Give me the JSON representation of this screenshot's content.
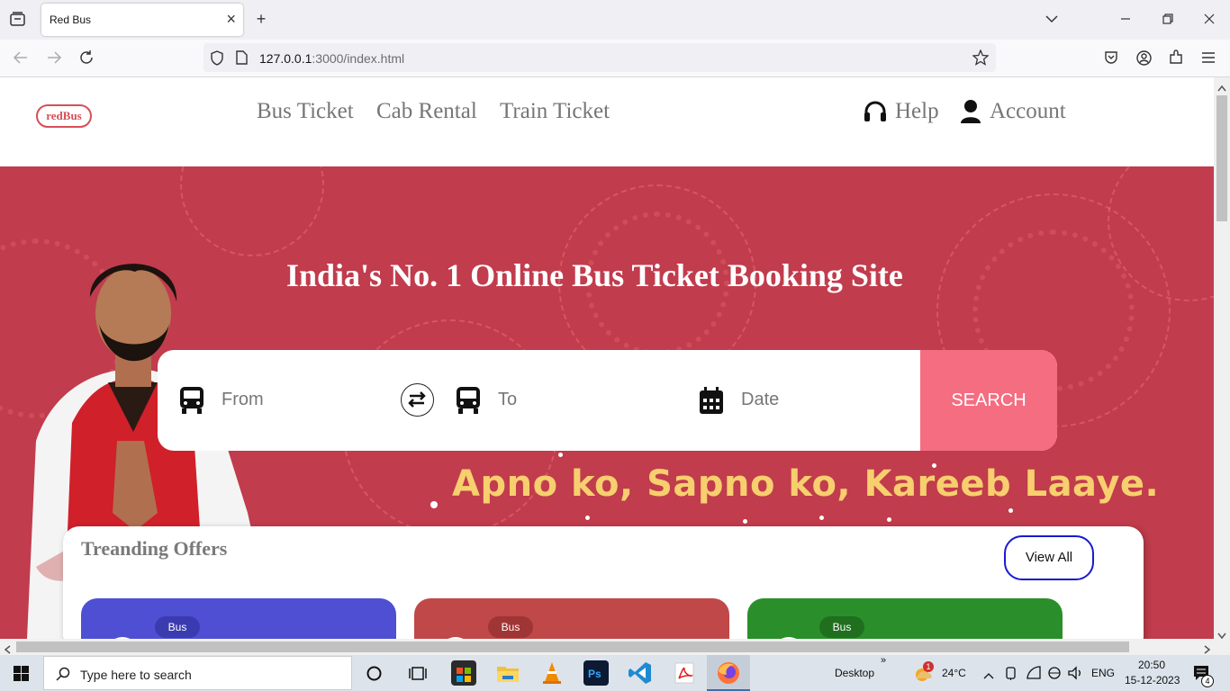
{
  "browser": {
    "tab_title": "Red Bus",
    "url_host": "127.0.0.1",
    "url_path": ":3000/index.html"
  },
  "header": {
    "logo_text": "redBus",
    "nav": [
      "Bus Ticket",
      "Cab Rental",
      "Train Ticket"
    ],
    "help": "Help",
    "account": "Account"
  },
  "hero": {
    "headline": "India's No. 1 Online Bus Ticket Booking Site",
    "tagline": "Apno ko, Sapno ko, Kareeb Laaye.",
    "search": {
      "from_placeholder": "From",
      "to_placeholder": "To",
      "date_placeholder": "Date",
      "search_label": "SEARCH"
    }
  },
  "offers": {
    "title": "Treanding Offers",
    "view_all": "View All",
    "cards": [
      {
        "badge": "Bus",
        "color": "#4f4fd4",
        "badge_color": "#3b3bb0"
      },
      {
        "badge": "Bus",
        "color": "#c04848",
        "badge_color": "#a03535"
      },
      {
        "badge": "Bus",
        "color": "#2a8f2a",
        "badge_color": "#1f6f1f"
      }
    ]
  },
  "taskbar": {
    "search_placeholder": "Type here to search",
    "desktop_label": "Desktop",
    "weather": "24°C",
    "language": "ENG",
    "time": "20:50",
    "date": "15-12-2023",
    "notifications": "4",
    "weather_badge": "1"
  },
  "colors": {
    "hero_bg": "#c13c4d",
    "search_btn": "#f56d80",
    "tagline": "#f7cf6e",
    "brand": "#d84e55"
  }
}
